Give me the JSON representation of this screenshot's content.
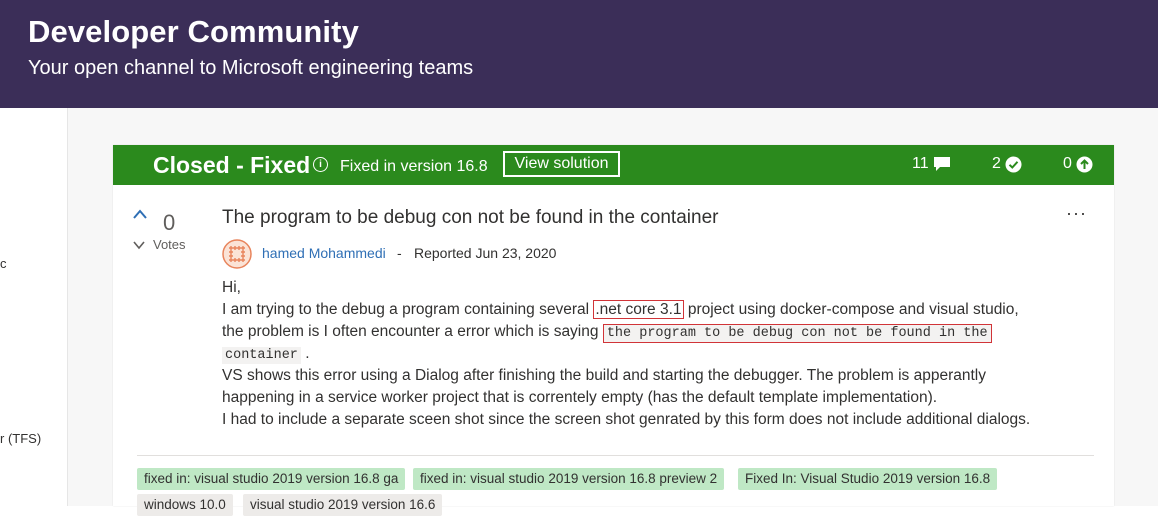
{
  "header": {
    "title": "Developer Community",
    "subtitle": "Your open channel to Microsoft engineering teams"
  },
  "left_panel": {
    "fragment1": "c",
    "fragment2": "r (TFS)"
  },
  "status": {
    "state": "Closed - Fixed",
    "info_icon": "info-icon",
    "fixed_version": "Fixed in version 16.8",
    "view_solution": "View solution",
    "comments": "11",
    "solutions": "2",
    "votes": "0",
    "color": "#2b8a1d"
  },
  "post": {
    "vote_count": "0",
    "vote_label": "Votes",
    "title": "The program to be debug con not be found in the container",
    "more": "···",
    "author": "hamed Mohammedi",
    "separator": "-",
    "reported": "Reported Jun 23, 2020",
    "body": {
      "l1": "Hi,",
      "l2a": "I am trying to the debug a program containing several ",
      "l2b": ".net core 3.1",
      "l2c": " project using docker-compose and visual studio,",
      "l3a": "the problem is I often encounter a error which is saying ",
      "l3b": "the program to be debug con not be found in the",
      "l4a": "container",
      "l4b": " .",
      "l5": "VS shows this error using a Dialog after finishing the build and starting the debugger. The problem is apperantly",
      "l6": "happening in a service worker project that is correntely empty (has the default template implementation).",
      "l7": "I had to include a separate sceen shot since the screen shot genrated by this form does not include additional dialogs."
    }
  },
  "tags": [
    "fixed in: visual studio 2019 version 16.8 ga",
    "fixed in: visual studio 2019 version 16.8 preview 2",
    "Fixed In: Visual Studio 2019 version 16.8",
    "windows 10.0",
    "visual studio 2019 version 16.6"
  ]
}
